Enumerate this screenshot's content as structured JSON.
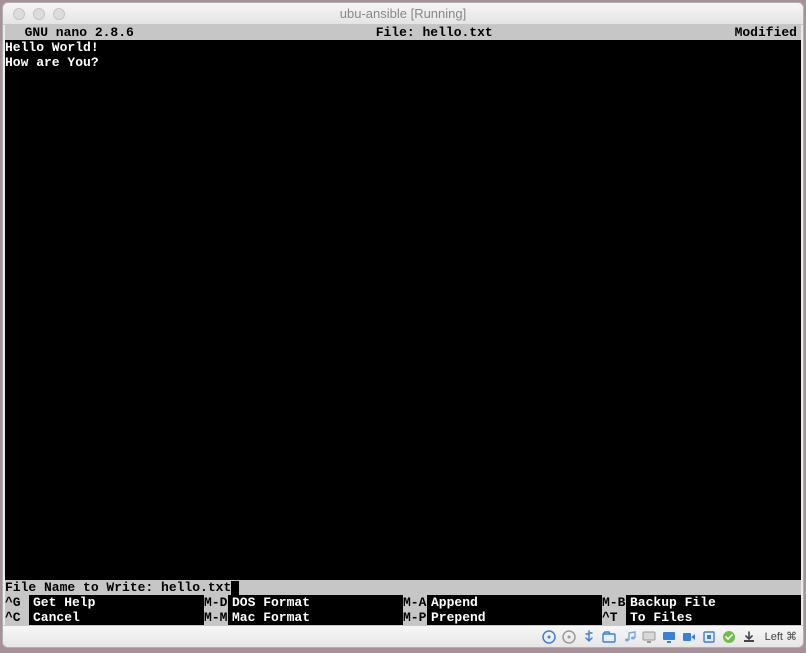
{
  "window": {
    "title": "ubu-ansible [Running]"
  },
  "nano": {
    "app": "  GNU nano 2.8.6",
    "file_label": "File: hello.txt",
    "modified": "Modified",
    "content_line1": "Hello World!",
    "content_line2": "How are You?",
    "prompt_label": "File Name to Write: ",
    "prompt_value": "hello.txt"
  },
  "shortcuts": {
    "r1c1_key": "^G",
    "r1c1_label": "Get Help",
    "r1c2_key": "M-D",
    "r1c2_label": "DOS Format",
    "r1c3_key": "M-A",
    "r1c3_label": "Append",
    "r1c4_key": "M-B",
    "r1c4_label": "Backup File",
    "r2c1_key": "^C",
    "r2c1_label": "Cancel",
    "r2c2_key": "M-M",
    "r2c2_label": "Mac Format",
    "r2c3_key": "M-P",
    "r2c3_label": "Prepend",
    "r2c4_key": "^T",
    "r2c4_label": "To Files"
  },
  "vmstatus": {
    "hostkey": "Left ⌘"
  }
}
